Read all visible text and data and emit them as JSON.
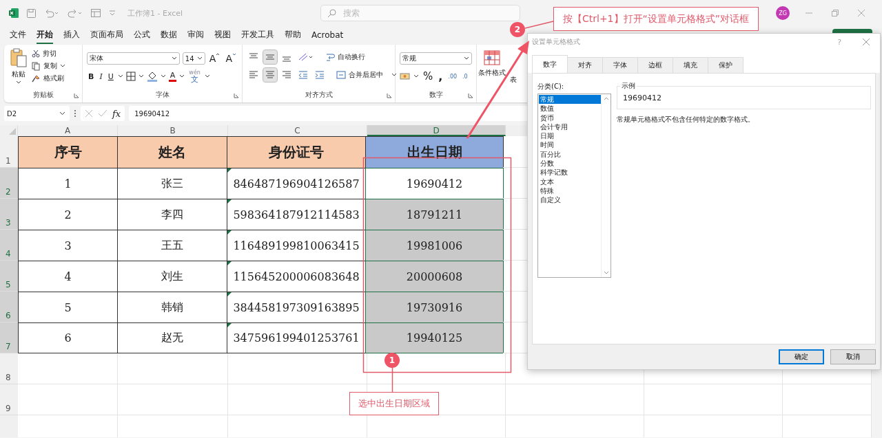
{
  "window": {
    "title": "工作簿1 - Excel",
    "search": {
      "placeholder": "搜索"
    },
    "avatar": "ZG"
  },
  "menu_tabs": [
    {
      "label": "文件",
      "selected": false
    },
    {
      "label": "开始",
      "selected": true
    },
    {
      "label": "插入",
      "selected": false
    },
    {
      "label": "页面布局",
      "selected": false
    },
    {
      "label": "公式",
      "selected": false
    },
    {
      "label": "数据",
      "selected": false
    },
    {
      "label": "审阅",
      "selected": false
    },
    {
      "label": "视图",
      "selected": false
    },
    {
      "label": "开发工具",
      "selected": false
    },
    {
      "label": "帮助",
      "selected": false
    },
    {
      "label": "Acrobat",
      "selected": false
    }
  ],
  "ribbon": {
    "clipboard": {
      "paste": "粘贴",
      "cut": "剪切",
      "copy": "复制",
      "format_painter": "格式刷",
      "label": "剪贴板"
    },
    "font": {
      "name": "宋体",
      "size": "14",
      "grow": "A",
      "shrink": "A",
      "bold": "B",
      "italic": "I",
      "underline": "U",
      "font_color_letter": "A",
      "phonetic_top": "wén",
      "phonetic_bottom": "文",
      "label": "字体"
    },
    "alignment": {
      "wrap": "自动换行",
      "merge": "合并后居中",
      "label": "对齐方式"
    },
    "number": {
      "format": "常规",
      "percent": "%",
      "comma": ",",
      "decimal_increase": ".00",
      "decimal_decrease": ".0",
      "label": "数字"
    },
    "styles": {
      "conditional": "条件格式",
      "table": "表"
    }
  },
  "formula_bar": {
    "name_box": "D2",
    "fx": "fx",
    "value": "19690412"
  },
  "sheet": {
    "columns": [
      {
        "letter": "A",
        "selected": false
      },
      {
        "letter": "B",
        "selected": false
      },
      {
        "letter": "C",
        "selected": false
      },
      {
        "letter": "D",
        "selected": true
      }
    ],
    "header_row": {
      "number": "1",
      "selected": false,
      "cells": [
        "序号",
        "姓名",
        "身份证号",
        "出生日期"
      ]
    },
    "rows": [
      {
        "number": "2",
        "selected": true,
        "active": true,
        "cells": [
          "1",
          "张三",
          "846487196904126587",
          "19690412"
        ]
      },
      {
        "number": "3",
        "selected": true,
        "active": false,
        "cells": [
          "2",
          "李四",
          "598364187912114583",
          "18791211"
        ]
      },
      {
        "number": "4",
        "selected": true,
        "active": false,
        "cells": [
          "3",
          "王五",
          "116489199810063415",
          "19981006"
        ]
      },
      {
        "number": "5",
        "selected": true,
        "active": false,
        "cells": [
          "4",
          "刘生",
          "115645200006083648",
          "20000608"
        ]
      },
      {
        "number": "6",
        "selected": true,
        "active": false,
        "cells": [
          "5",
          "韩销",
          "384458197309163895",
          "19730916"
        ]
      },
      {
        "number": "7",
        "selected": true,
        "active": false,
        "cells": [
          "6",
          "赵无",
          "347596199401253761",
          "19940125"
        ]
      }
    ],
    "empty_rows": [
      {
        "number": "8"
      },
      {
        "number": "9"
      }
    ]
  },
  "dialog": {
    "title": "设置单元格格式",
    "help": "?",
    "tabs": [
      {
        "label": "数字",
        "selected": true
      },
      {
        "label": "对齐",
        "selected": false
      },
      {
        "label": "字体",
        "selected": false
      },
      {
        "label": "边框",
        "selected": false
      },
      {
        "label": "填充",
        "selected": false
      },
      {
        "label": "保护",
        "selected": false
      }
    ],
    "category_label": "分类(C):",
    "categories": [
      {
        "label": "常规",
        "selected": true
      },
      {
        "label": "数值",
        "selected": false
      },
      {
        "label": "货币",
        "selected": false
      },
      {
        "label": "会计专用",
        "selected": false
      },
      {
        "label": "日期",
        "selected": false
      },
      {
        "label": "时间",
        "selected": false
      },
      {
        "label": "百分比",
        "selected": false
      },
      {
        "label": "分数",
        "selected": false
      },
      {
        "label": "科学记数",
        "selected": false
      },
      {
        "label": "文本",
        "selected": false
      },
      {
        "label": "特殊",
        "selected": false
      },
      {
        "label": "自定义",
        "selected": false
      }
    ],
    "sample": {
      "label": "示例",
      "value": "19690412"
    },
    "description": "常规单元格格式不包含任何特定的数字格式。",
    "buttons": [
      {
        "label": "确定",
        "default": true
      },
      {
        "label": "取消",
        "default": false
      }
    ]
  },
  "annotations": [
    {
      "number": "2",
      "text": "按【Ctrl+1】打开“设置单元格格式”对话框"
    },
    {
      "number": "1",
      "text": "选中出生日期区域"
    }
  ]
}
